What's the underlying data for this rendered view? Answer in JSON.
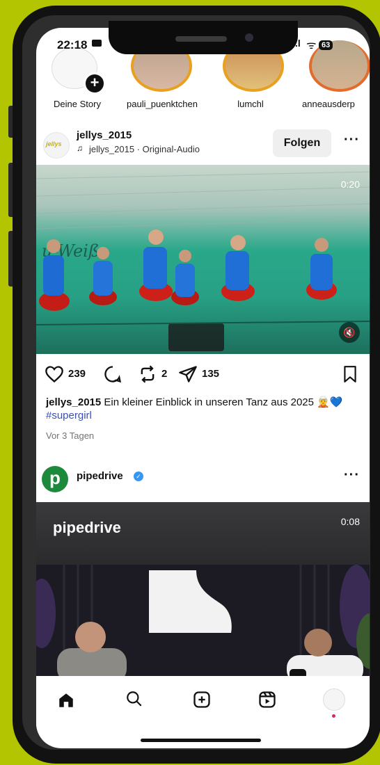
{
  "status": {
    "time": "22:18",
    "battery": "63"
  },
  "stories": [
    {
      "label": "Deine Story"
    },
    {
      "label": "pauli_puenktchen"
    },
    {
      "label": "lumchl"
    },
    {
      "label": "anneausderp"
    }
  ],
  "post1": {
    "username": "jellys_2015",
    "audio": "jellys_2015 · Original-Audio",
    "follow_label": "Folgen",
    "duration": "0:20",
    "video_sign": "u-Weiß",
    "likes": "239",
    "reposts": "2",
    "shares": "135",
    "caption_user": "jellys_2015",
    "caption_text": "Ein kleiner Einblick in unseren Tanz aus 2025",
    "caption_tag": "#supergirl",
    "timestamp": "Vor 3 Tagen",
    "avatar_text": "jellys"
  },
  "post2": {
    "username": "pipedrive",
    "avatar_letter": "p",
    "video_title": "pipedrive",
    "duration": "0:08"
  },
  "nav": [
    "home-icon",
    "search-icon",
    "create-icon",
    "reels-icon",
    "profile-avatar"
  ]
}
